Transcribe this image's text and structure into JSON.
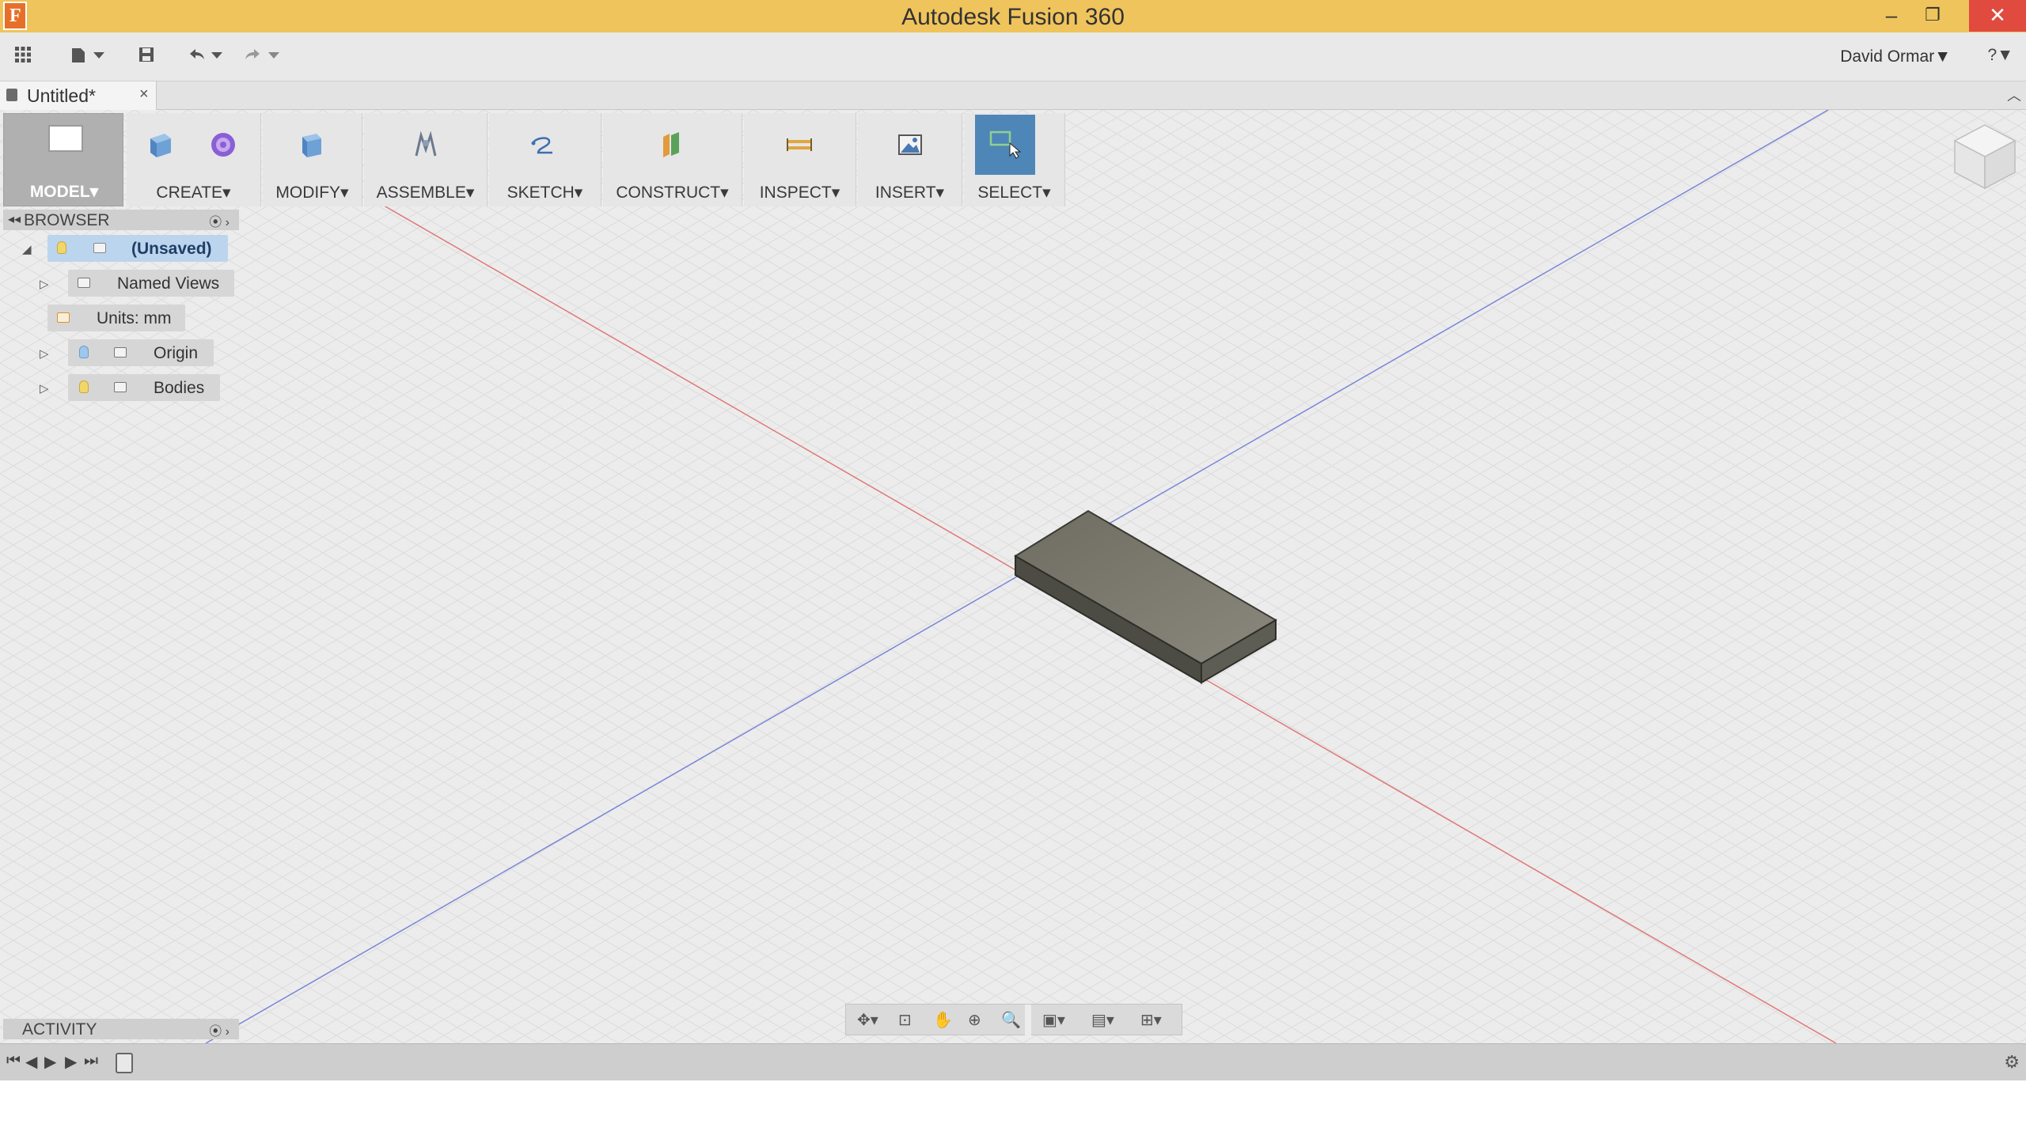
{
  "window": {
    "title": "Autodesk Fusion 360",
    "logo_letter": "F",
    "minimize": "–",
    "restore": "❐",
    "close": "✕",
    "close_color": "#e04a3f"
  },
  "quickbar": {
    "user": "David Ormar▼",
    "help": "?▼",
    "icons": [
      "apps-grid-icon",
      "file-menu-icon",
      "save-icon",
      "undo-icon",
      "redo-icon"
    ]
  },
  "doc_tab": {
    "name": "Untitled*",
    "close": "×"
  },
  "toolbar": {
    "workspace": "MODEL▾",
    "groups": [
      {
        "label": "CREATE▾"
      },
      {
        "label": "MODIFY▾"
      },
      {
        "label": "ASSEMBLE▾"
      },
      {
        "label": "SKETCH▾"
      },
      {
        "label": "CONSTRUCT▾"
      },
      {
        "label": "INSPECT▾"
      },
      {
        "label": "INSERT▾"
      },
      {
        "label": "SELECT▾"
      }
    ]
  },
  "browser": {
    "title": "BROWSER",
    "root": "(Unsaved)",
    "named_views": "Named Views",
    "units": "Units: mm",
    "origin": "Origin",
    "bodies": "Bodies"
  },
  "activity": {
    "title": "ACTIVITY"
  },
  "colors": {
    "title_bar": "#f0c45c",
    "x_axis": "#e07878",
    "z_axis": "#7a86d8",
    "body_top": "#7a786c",
    "select_highlight": "#4f86b8"
  }
}
